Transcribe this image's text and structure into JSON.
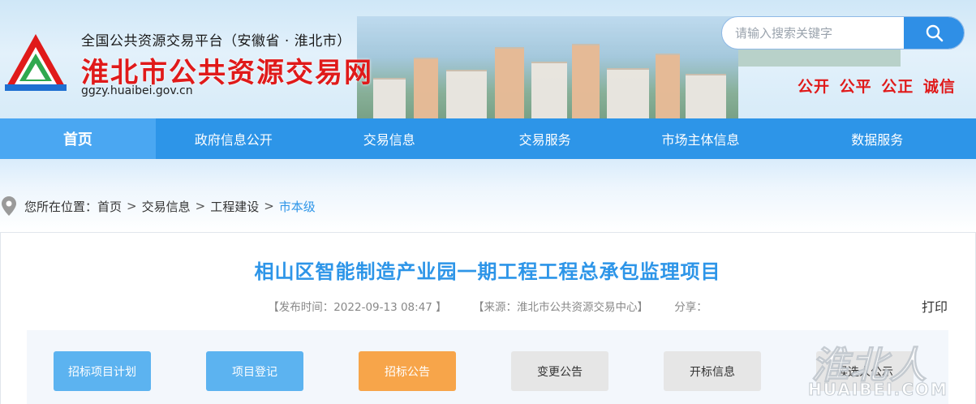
{
  "header": {
    "platform_line": "全国公共资源交易平台（安徽省 · 淮北市）",
    "site_title": "淮北市公共资源交易网",
    "domain": "ggzy.huaibei.gov.cn",
    "slogan": "公开 公平 公正 诚信",
    "search": {
      "placeholder": "请输入搜索关键字",
      "button_icon": "search-icon"
    },
    "colors": {
      "title": "#e01a1a",
      "accent": "#2d95e8"
    }
  },
  "nav": {
    "items": [
      {
        "label": "首页",
        "active": true
      },
      {
        "label": "政府信息公开",
        "active": false
      },
      {
        "label": "交易信息",
        "active": false
      },
      {
        "label": "交易服务",
        "active": false
      },
      {
        "label": "市场主体信息",
        "active": false
      },
      {
        "label": "数据服务",
        "active": false
      }
    ]
  },
  "breadcrumb": {
    "prefix": "您所在位置：",
    "items": [
      "首页",
      "交易信息",
      "工程建设",
      "市本级"
    ],
    "separator": ">"
  },
  "article": {
    "title": "相山区智能制造产业园一期工程工程总承包监理项目",
    "publish_time": "【发布时间：2022-09-13 08:47 】",
    "source": "【来源：淮北市公共资源交易中心】",
    "share": "分享：",
    "print": "打印"
  },
  "tabs": [
    {
      "label": "招标项目计划",
      "style": "blue"
    },
    {
      "label": "项目登记",
      "style": "blue"
    },
    {
      "label": "招标公告",
      "style": "orange"
    },
    {
      "label": "变更公告",
      "style": "gray"
    },
    {
      "label": "开标信息",
      "style": "gray"
    },
    {
      "label": "候选人公示",
      "style": "gray"
    }
  ],
  "watermark": {
    "cn": "淮北人",
    "en": "HUAIBEI.COM"
  }
}
